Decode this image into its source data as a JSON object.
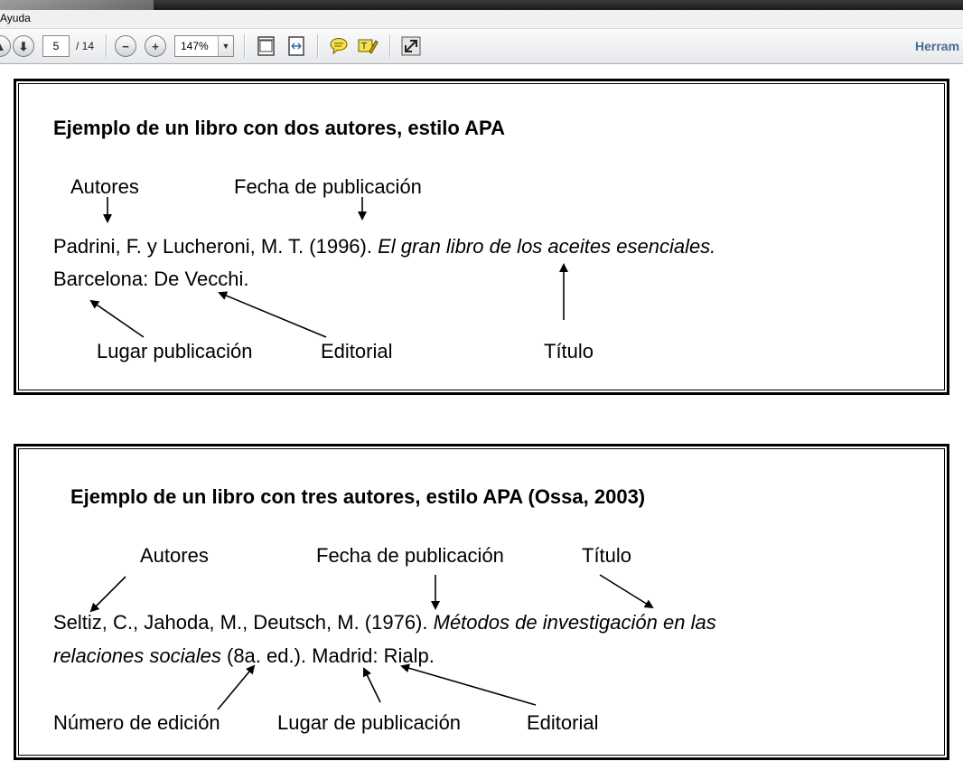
{
  "menu": {
    "item_ayuda": "Ayuda"
  },
  "toolbar": {
    "page_current": "5",
    "page_total": "/ 14",
    "zoom": "147%",
    "tools_label": "Herram"
  },
  "example1": {
    "heading": "Ejemplo de un libro con dos autores,  estilo APA",
    "label_authors": "Autores",
    "label_date": "Fecha de publicación",
    "citation_line1_plain": "Padrini, F. y Lucheroni, M. T. (1996). ",
    "citation_line1_italic": "El gran libro de los aceites esenciales.",
    "citation_line2": "Barcelona: De Vecchi.",
    "label_place": "Lugar publicación",
    "label_publisher": "Editorial",
    "label_title": "Título"
  },
  "example2": {
    "heading": "Ejemplo de un libro con tres  autores, estilo APA (Ossa, 2003)",
    "label_authors": "Autores",
    "label_date": "Fecha de publicación",
    "label_title": "Título",
    "citation_line1_plain": "Seltiz, C., Jahoda, M., Deutsch, M. (1976). ",
    "citation_line1_italic": "Métodos de investigación en las",
    "citation_line2_italic": "relaciones sociales",
    "citation_line2_plain": " (8a. ed.). Madrid: Rialp.",
    "label_edition": "Número de edición",
    "label_place": "Lugar de publicación",
    "label_publisher": "Editorial"
  }
}
